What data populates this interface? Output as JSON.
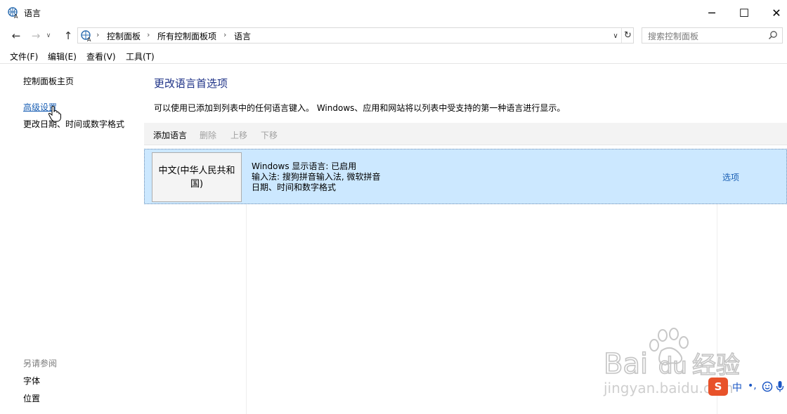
{
  "window": {
    "title": "语言",
    "minimize_glyph": "─",
    "maximize_glyph": "☐",
    "close_glyph": "✕"
  },
  "navigation": {
    "back_glyph": "←",
    "forward_glyph": "→",
    "recent_glyph": "∨",
    "up_glyph": "↑",
    "refresh_glyph": "↻",
    "dropdown_glyph": "∨",
    "breadcrumb": [
      "控制面板",
      "所有控制面板项",
      "语言"
    ],
    "separator": "›"
  },
  "search": {
    "placeholder": "搜索控制面板"
  },
  "menu": [
    "文件(F)",
    "编辑(E)",
    "查看(V)",
    "工具(T)"
  ],
  "sidebar": {
    "links": [
      "控制面板主页",
      "高级设置",
      "更改日期、时间或数字格式"
    ],
    "see_also_title": "另请参阅",
    "see_also": [
      "字体",
      "位置"
    ]
  },
  "main": {
    "heading": "更改语言首选项",
    "description": "可以使用已添加到列表中的任何语言键入。 Windows、应用和网站将以列表中受支持的第一种语言进行显示。",
    "toolbar": [
      {
        "label": "添加语言",
        "enabled": true
      },
      {
        "label": "删除",
        "enabled": false
      },
      {
        "label": "上移",
        "enabled": false
      },
      {
        "label": "下移",
        "enabled": false
      }
    ],
    "languages": [
      {
        "name": "中文(中华人民共和国)",
        "details": [
          "Windows 显示语言: 已启用",
          "输入法: 搜狗拼音输入法, 微软拼音",
          "日期、时间和数字格式"
        ],
        "options_label": "选项"
      }
    ]
  },
  "watermark": {
    "brand": "Bai",
    "brand2": "du",
    "product": "经验",
    "url": "jingyan.baidu.com"
  },
  "ime": {
    "logo": "S",
    "mode": "中",
    "punct": "•,"
  },
  "colors": {
    "heading": "#1e3287",
    "link": "#1a5fb4",
    "selection": "#cce8ff",
    "toolbar": "#f3f3f3",
    "ime_logo": "#e8522a"
  }
}
